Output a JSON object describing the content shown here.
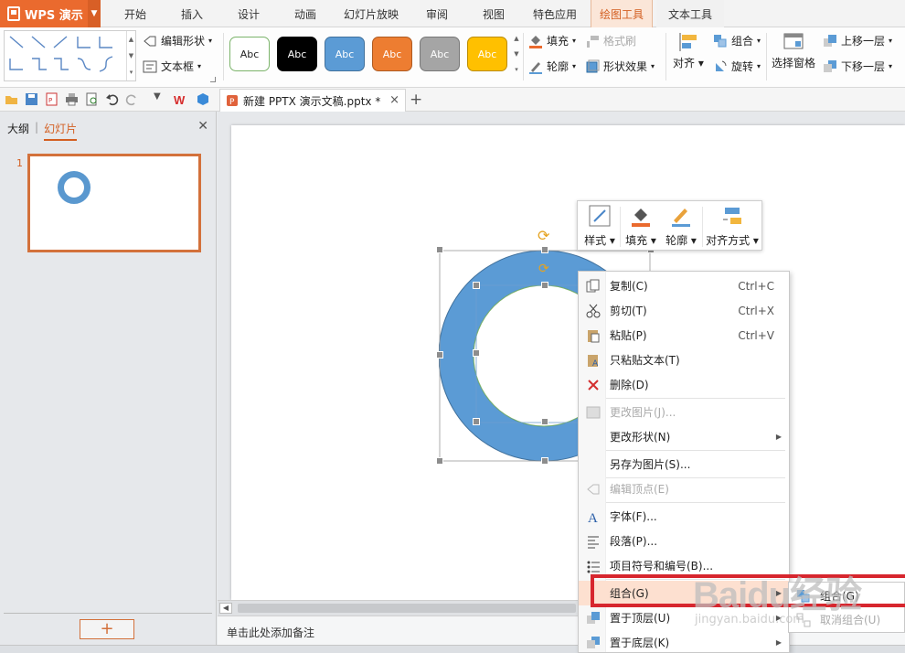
{
  "app": {
    "name": "WPS 演示"
  },
  "tabs": [
    "开始",
    "插入",
    "设计",
    "动画",
    "幻灯片放映",
    "审阅",
    "视图",
    "特色应用",
    "绘图工具",
    "文本工具"
  ],
  "ribbon": {
    "edit_shape": "编辑形状",
    "text_box": "文本框",
    "style_presets": [
      {
        "label": "Abc",
        "bg": "#ffffff",
        "fg": "#222222",
        "border": "#7bb36a"
      },
      {
        "label": "Abc",
        "bg": "#000000",
        "fg": "#ffffff",
        "border": "#000000"
      },
      {
        "label": "Abc",
        "bg": "#5b9bd5",
        "fg": "#ffffff",
        "border": "#41719c"
      },
      {
        "label": "Abc",
        "bg": "#ed7d31",
        "fg": "#ffffff",
        "border": "#ae5a21"
      },
      {
        "label": "Abc",
        "bg": "#a5a5a5",
        "fg": "#ffffff",
        "border": "#787878"
      },
      {
        "label": "Abc",
        "bg": "#ffc000",
        "fg": "#ffffff",
        "border": "#bc8c00"
      }
    ],
    "fill": "填充",
    "format_painter": "格式刷",
    "outline": "轮廓",
    "shape_effects": "形状效果",
    "align": "对齐",
    "group": "组合",
    "rotate": "旋转",
    "selection_pane": "选择窗格",
    "bring_forward": "上移一层",
    "send_backward": "下移一层"
  },
  "document": {
    "tab_title": "新建 PPTX 演示文稿.pptx *"
  },
  "left_pane": {
    "tab_outline": "大纲",
    "tab_slides": "幻灯片",
    "slide_number": "1"
  },
  "mini_toolbar": {
    "style": "样式",
    "fill": "填充",
    "outline": "轮廓",
    "align": "对齐方式"
  },
  "context_menu": {
    "items": [
      {
        "label": "复制(C)",
        "shortcut": "Ctrl+C"
      },
      {
        "label": "剪切(T)",
        "shortcut": "Ctrl+X"
      },
      {
        "label": "粘贴(P)",
        "shortcut": "Ctrl+V"
      },
      {
        "label": "只粘贴文本(T)",
        "shortcut": ""
      },
      {
        "label": "删除(D)",
        "shortcut": ""
      },
      {
        "label": "更改图片(J)...",
        "shortcut": ""
      },
      {
        "label": "更改形状(N)",
        "shortcut": ""
      },
      {
        "label": "另存为图片(S)...",
        "shortcut": ""
      },
      {
        "label": "编辑顶点(E)",
        "shortcut": ""
      },
      {
        "label": "字体(F)...",
        "shortcut": ""
      },
      {
        "label": "段落(P)...",
        "shortcut": ""
      },
      {
        "label": "项目符号和编号(B)...",
        "shortcut": ""
      },
      {
        "label": "组合(G)",
        "shortcut": ""
      },
      {
        "label": "置于顶层(U)",
        "shortcut": ""
      },
      {
        "label": "置于底层(K)",
        "shortcut": ""
      }
    ]
  },
  "submenu": {
    "group": "组合(G)",
    "ungroup": "取消组合(U)"
  },
  "notes_placeholder": "单击此处添加备注",
  "watermark": {
    "main": "Baidu经验",
    "sub": "jingyan.baidu.com"
  },
  "colors": {
    "accent": "#ea6a2e",
    "ring": "#5b9bd5",
    "highlight_box": "#d7262e"
  }
}
